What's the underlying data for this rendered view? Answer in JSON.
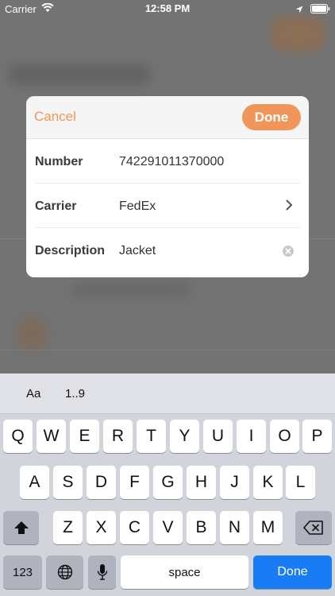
{
  "status_bar": {
    "carrier": "Carrier",
    "time": "12:58 PM"
  },
  "modal": {
    "cancel_label": "Cancel",
    "done_label": "Done",
    "accent_color": "#f0965a",
    "rows": [
      {
        "label": "Number",
        "value": "742291011370000"
      },
      {
        "label": "Carrier",
        "value": "FedEx"
      },
      {
        "label": "Description",
        "value": "Jacket"
      }
    ]
  },
  "keyboard": {
    "toolbar": [
      "Aa",
      "1..9"
    ],
    "row1": [
      "Q",
      "W",
      "E",
      "R",
      "T",
      "Y",
      "U",
      "I",
      "O",
      "P"
    ],
    "row2": [
      "A",
      "S",
      "D",
      "F",
      "G",
      "H",
      "J",
      "K",
      "L"
    ],
    "row3": [
      "Z",
      "X",
      "C",
      "V",
      "B",
      "N",
      "M"
    ],
    "numbers_label": "123",
    "space_label": "space",
    "done_label": "Done"
  }
}
